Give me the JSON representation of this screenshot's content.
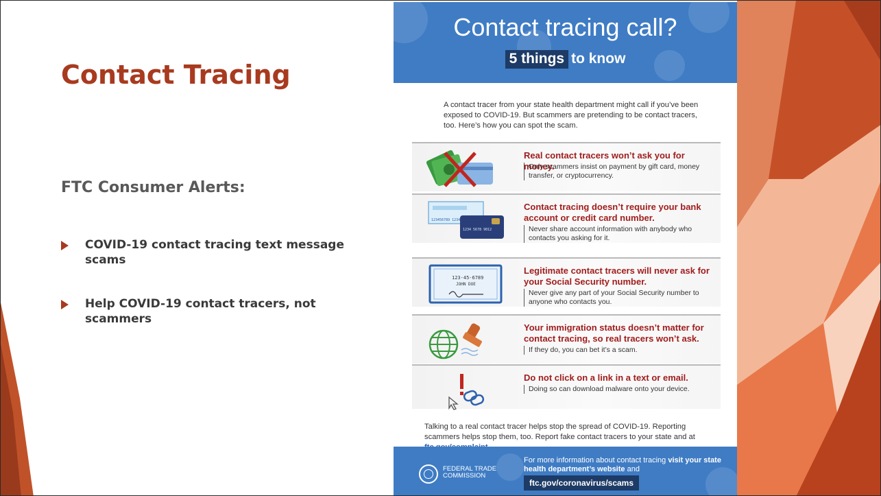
{
  "slide": {
    "title": "Contact Tracing",
    "subtitle": "FTC Consumer Alerts:",
    "bullets": [
      "COVID-19 contact tracing text message scams",
      "Help COVID-19 contact tracers, not scammers"
    ]
  },
  "poster": {
    "title": "Contact tracing call?",
    "sub_highlight": "5 things",
    "sub_rest": "to know",
    "intro": "A contact tracer from your state health department might call if you’ve been exposed to COVID-19. But scammers are pretending to be contact tracers, too. Here’s how you can spot the scam.",
    "items": [
      {
        "icon": "money-cross-icon",
        "headline": "Real contact tracers won’t ask you for money.",
        "body": "Only scammers insist on payment by gift card, money transfer, or cryptocurrency."
      },
      {
        "icon": "check-card-icon",
        "headline": "Contact tracing doesn’t require your bank account or credit card number.",
        "body": "Never share account information with anybody who contacts you asking for it.",
        "card_text": "1234 5678 9012",
        "check_text": "123456789 1234"
      },
      {
        "icon": "social-security-card-icon",
        "headline": "Legitimate contact tracers will never ask for your Social Security number.",
        "body": "Never give any part of your Social Security number to anyone who contacts you.",
        "card_number": "123-45-6789",
        "card_name": "JOHN DOE"
      },
      {
        "icon": "globe-stamp-icon",
        "headline": "Your immigration status doesn’t matter for contact tracing, so real tracers won’t ask.",
        "body": "If they do, you can bet it’s a scam."
      },
      {
        "icon": "link-warning-icon",
        "headline": "Do not click on a link in a text or email.",
        "body": "Doing so can download malware onto your device."
      }
    ],
    "footer_text_1": "Talking to a real contact tracer helps stop the spread of COVID-19. Reporting scammers helps stop them, too. Report fake contact tracers to your state and at ",
    "footer_link": "ftc.gov/complaint",
    "footer_text_2": ".",
    "agency_line1": "FEDERAL TRADE",
    "agency_line2": "COMMISSION",
    "more_info_1": "For more information about contact tracing ",
    "more_info_bold": "visit your state health department’s website",
    "more_info_2": " and",
    "url": "ftc.gov/coronavirus/scams"
  },
  "colors": {
    "title_red": "#a83a1f",
    "poster_blue": "#3f7cc4",
    "navy": "#1d3b66",
    "headline_red": "#a01d1d",
    "orange_accent": "#e8662f"
  }
}
